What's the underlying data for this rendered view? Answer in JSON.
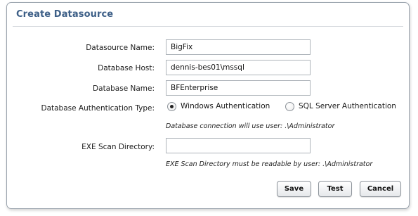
{
  "dialog": {
    "title": "Create Datasource"
  },
  "fields": {
    "datasource_name": {
      "label": "Datasource Name:",
      "value": "BigFix"
    },
    "database_host": {
      "label": "Database Host:",
      "value": "dennis-bes01\\mssql"
    },
    "database_name": {
      "label": "Database Name:",
      "value": "BFEnterprise"
    },
    "auth_type": {
      "label": "Database Authentication Type:",
      "options": [
        {
          "label": "Windows Authentication",
          "selected": true
        },
        {
          "label": "SQL Server Authentication",
          "selected": false
        }
      ],
      "hint": "Database connection will use user: .\\Administrator"
    },
    "exe_scan_directory": {
      "label": "EXE Scan Directory:",
      "value": "",
      "hint": "EXE Scan Directory must be readable by user: .\\Administrator"
    }
  },
  "buttons": {
    "save": "Save",
    "test": "Test",
    "cancel": "Cancel"
  },
  "colors": {
    "title": "#3d5f87",
    "border": "#9aa3ad"
  }
}
